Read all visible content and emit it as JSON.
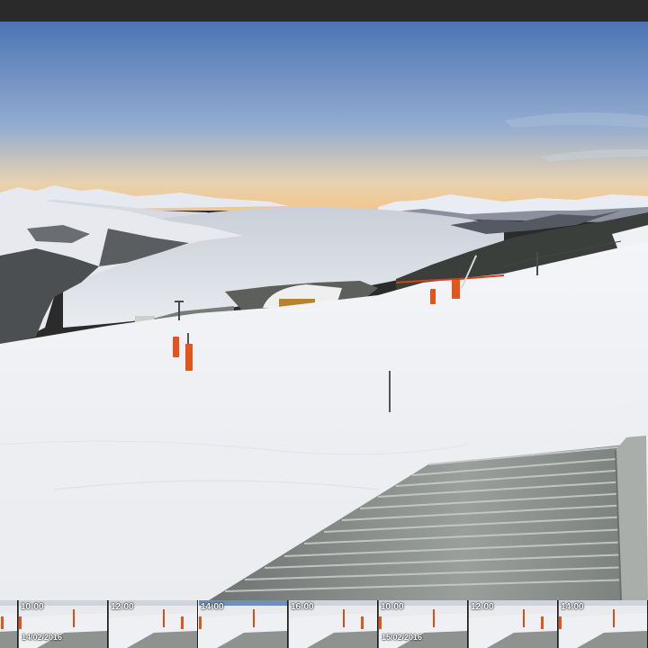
{
  "viewer": {
    "image_icon": "webcam-panorama",
    "colors": {
      "sky_top": "#4f78b8",
      "sky_horizon": "#f1c68e",
      "snow": "#f3f4f6",
      "cloud_sea": "#dfe3e9",
      "pole": "#e2561b",
      "roof": "#8a8f8c"
    }
  },
  "thumbnails": {
    "items": [
      {
        "time": "",
        "date": ""
      },
      {
        "time": "10:00",
        "date": "14/02/2016"
      },
      {
        "time": "12:00",
        "date": ""
      },
      {
        "time": "14:00",
        "date": ""
      },
      {
        "time": "16:00",
        "date": ""
      },
      {
        "time": "10:00",
        "date": "15/02/2016"
      },
      {
        "time": "12:00",
        "date": ""
      },
      {
        "time": "14:00",
        "date": ""
      }
    ]
  }
}
